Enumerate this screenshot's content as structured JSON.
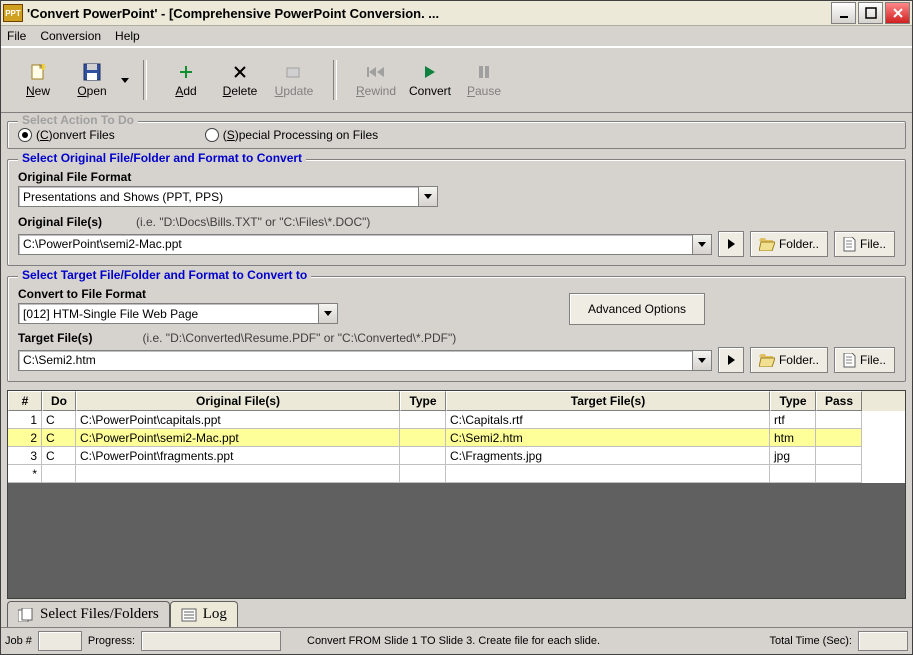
{
  "titlebar": {
    "title": "'Convert PowerPoint' - [Comprehensive PowerPoint Conversion. ..."
  },
  "menu": {
    "file": "File",
    "conversion": "Conversion",
    "help": "Help"
  },
  "toolbar": {
    "new": "New",
    "open": "Open",
    "add": "Add",
    "delete": "Delete",
    "update": "Update",
    "rewind": "Rewind",
    "convert": "Convert",
    "pause": "Pause"
  },
  "action_group": {
    "legend": "Select Action To Do",
    "convert": "(C)onvert Files",
    "special": "(S)pecial Processing on Files"
  },
  "source_group": {
    "legend": "Select Original File/Folder and Format to Convert",
    "format_label": "Original File Format",
    "format_value": "Presentations and Shows (PPT, PPS)",
    "files_label": "Original File(s)",
    "files_hint": "(i.e. \"D:\\Docs\\Bills.TXT\"  or \"C:\\Files\\*.DOC\")",
    "files_value": "C:\\PowerPoint\\semi2-Mac.ppt",
    "folder_btn": "Folder..",
    "file_btn": "File.."
  },
  "target_group": {
    "legend": "Select Target File/Folder and Format to Convert to",
    "format_label": "Convert to File Format",
    "format_value": "[012] HTM-Single File Web Page",
    "adv_btn": "Advanced Options",
    "files_label": "Target File(s)",
    "files_hint": "(i.e. \"D:\\Converted\\Resume.PDF\" or \"C:\\Converted\\*.PDF\")",
    "files_value": "C:\\Semi2.htm",
    "folder_btn": "Folder..",
    "file_btn": "File.."
  },
  "table": {
    "headers": {
      "num": "#",
      "do": "Do",
      "orig": "Original File(s)",
      "otype": "Type",
      "targ": "Target File(s)",
      "ttype": "Type",
      "pass": "Pass"
    },
    "rows": [
      {
        "num": "1",
        "do": "C",
        "orig": "C:\\PowerPoint\\capitals.ppt",
        "otype": "",
        "targ": "C:\\Capitals.rtf",
        "ttype": "rtf",
        "pass": "",
        "sel": false
      },
      {
        "num": "2",
        "do": "C",
        "orig": "C:\\PowerPoint\\semi2-Mac.ppt",
        "otype": "",
        "targ": "C:\\Semi2.htm",
        "ttype": "htm",
        "pass": "",
        "sel": true
      },
      {
        "num": "3",
        "do": "C",
        "orig": "C:\\PowerPoint\\fragments.ppt",
        "otype": "",
        "targ": "C:\\Fragments.jpg",
        "ttype": "jpg",
        "pass": "",
        "sel": false
      },
      {
        "num": "*",
        "do": "",
        "orig": "",
        "otype": "",
        "targ": "",
        "ttype": "",
        "pass": "",
        "sel": false
      }
    ]
  },
  "bottom_tabs": {
    "files": "Select Files/Folders",
    "log": "Log"
  },
  "statusbar": {
    "job_label": "Job #",
    "job_val": "",
    "progress_label": "Progress:",
    "progress_val": "",
    "message": "Convert FROM Slide 1 TO Slide 3. Create file for each slide.",
    "time_label": "Total Time (Sec):",
    "time_val": ""
  }
}
